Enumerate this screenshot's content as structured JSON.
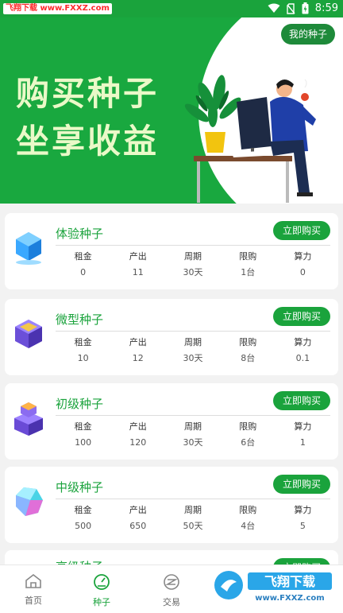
{
  "status_bar": {
    "watermark": "飞翔下载 www.FXXZ.com",
    "time": "8:59"
  },
  "banner": {
    "slogan_line1": "购买种子",
    "slogan_line2": "坐享收益",
    "my_seeds_label": "我的种子"
  },
  "stat_labels": {
    "rent": "租金",
    "output": "产出",
    "cycle": "周期",
    "limit": "限购",
    "power": "算力"
  },
  "buy_label": "立即购买",
  "seeds": [
    {
      "name": "体验种子",
      "rent": "0",
      "output": "11",
      "cycle": "30天",
      "limit": "1台",
      "power": "0",
      "icon": "blue-cube-icon"
    },
    {
      "name": "微型种子",
      "rent": "10",
      "output": "12",
      "cycle": "30天",
      "limit": "8台",
      "power": "0.1",
      "icon": "purple-gold-cube-icon"
    },
    {
      "name": "初级种子",
      "rent": "100",
      "output": "120",
      "cycle": "30天",
      "limit": "6台",
      "power": "1",
      "icon": "purple-stack-icon"
    },
    {
      "name": "中级种子",
      "rent": "500",
      "output": "650",
      "cycle": "50天",
      "limit": "4台",
      "power": "5",
      "icon": "gem-icon"
    },
    {
      "name": "高级种子",
      "icon": "partial-card"
    }
  ],
  "tabs": [
    {
      "label": "首页",
      "icon": "home-icon"
    },
    {
      "label": "种子",
      "icon": "gauge-icon"
    },
    {
      "label": "交易",
      "icon": "trade-icon"
    }
  ],
  "colors": {
    "brand": "#1aa33c",
    "slogan": "#eaf9c8"
  }
}
